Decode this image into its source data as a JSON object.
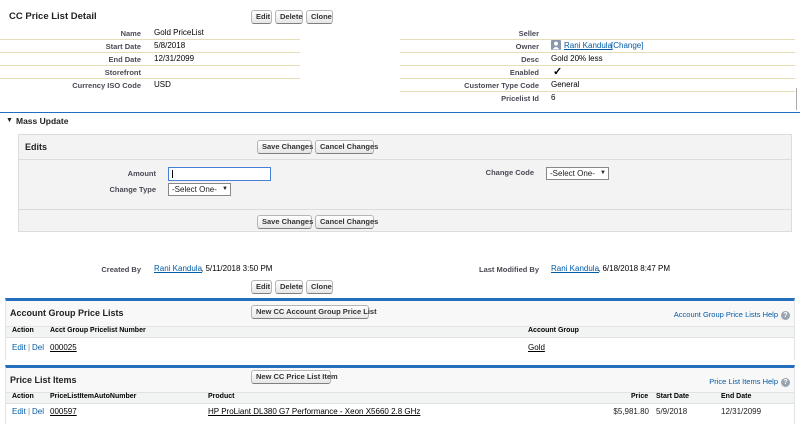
{
  "header": {
    "title": "CC Price List Detail"
  },
  "buttons": {
    "edit": "Edit",
    "delete": "Delete",
    "clone": "Clone"
  },
  "details": {
    "name_label": "Name",
    "name": "Gold PriceList",
    "start_label": "Start Date",
    "start": "5/8/2018",
    "end_label": "End Date",
    "end": "12/31/2099",
    "storefront_label": "Storefront",
    "storefront": "",
    "currency_label": "Currency ISO Code",
    "currency": "USD",
    "seller_label": "Seller",
    "seller": "",
    "owner_label": "Owner",
    "owner": "Rani Kandula",
    "owner_change": "[Change]",
    "desc_label": "Desc",
    "desc": "Gold 20% less",
    "enabled_label": "Enabled",
    "enabled_mark": "✓",
    "ctc_label": "Customer Type Code",
    "ctc": "General",
    "plid_label": "Pricelist Id",
    "plid": "6"
  },
  "mass_update": {
    "toggle": "▼",
    "title": "Mass Update",
    "edits_title": "Edits",
    "save": "Save Changes",
    "cancel": "Cancel Changes",
    "amount_label": "Amount",
    "amount_value": "",
    "change_type_label": "Change Type",
    "change_type_value": "-Select One-",
    "change_code_label": "Change Code",
    "change_code_value": "-Select One-"
  },
  "audit": {
    "created_label": "Created By",
    "created_user": "Rani Kandula",
    "created_date": ", 5/11/2018 3:50 PM",
    "modified_label": "Last Modified By",
    "modified_user": "Rani Kandula",
    "modified_date": ", 6/18/2018 8:47 PM"
  },
  "account_group": {
    "title": "Account Group Price Lists",
    "new_button": "New CC Account Group Price List",
    "help": "Account Group Price Lists Help",
    "help_icon": "?",
    "columns": [
      "Action",
      "Acct Group Pricelist Number",
      "Account Group"
    ],
    "rows": [
      {
        "edit": "Edit",
        "sep": "|",
        "del": "Del",
        "number": "000025",
        "group": "Gold"
      }
    ]
  },
  "price_items": {
    "title": "Price List Items",
    "new_button": "New CC Price List Item",
    "help": "Price List Items Help",
    "help_icon": "?",
    "columns": [
      "Action",
      "PriceListItemAutoNumber",
      "Product",
      "Price",
      "Start Date",
      "End Date"
    ],
    "rows": [
      {
        "edit": "Edit",
        "sep": "|",
        "del": "Del",
        "number": "000597",
        "product": "HP ProLiant DL380 G7 Performance - Xeon X5660 2.8 GHz",
        "price": "$5,981.80",
        "start": "5/9/2018",
        "end": "12/31/2099"
      }
    ]
  },
  "colors": {
    "accent": "#236fbd",
    "link": "#015ba7",
    "divider": "#e3deb8"
  }
}
